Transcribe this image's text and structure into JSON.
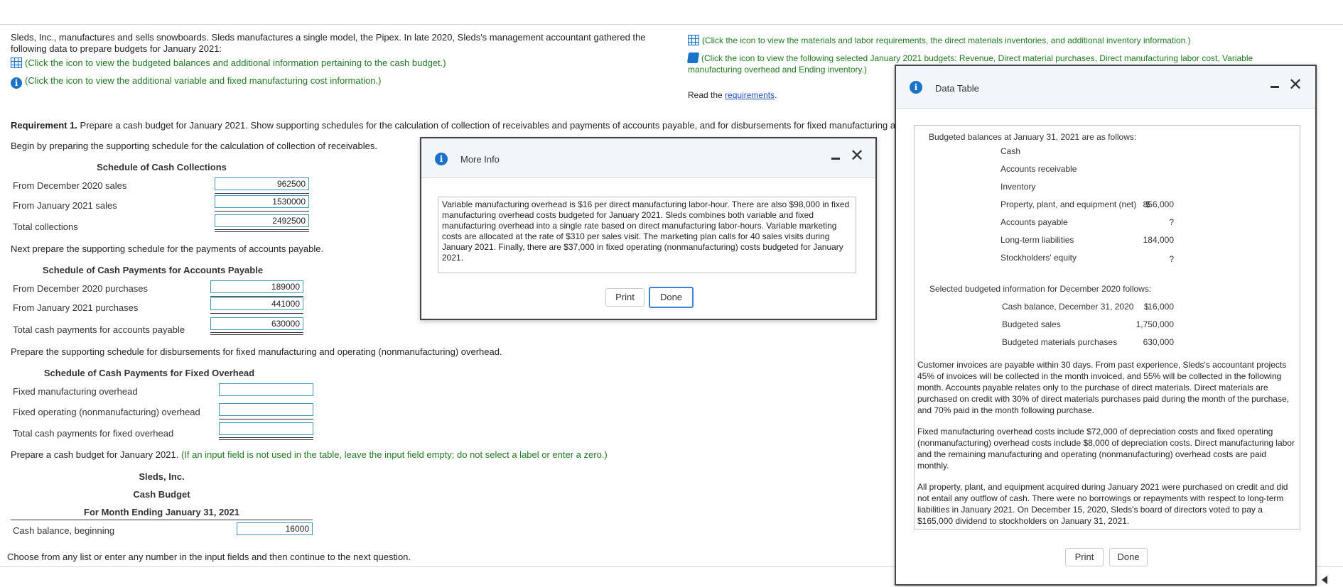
{
  "problem": {
    "intro": "Sleds, Inc., manufactures and sells snowboards. Sleds manufactures a single model, the Pipex. In late 2020, Sleds's management accountant gathered the following data to prepare budgets for January 2021:",
    "link_cash": "(Click the icon to view the budgeted balances and additional information pertaining to the cash budget.)",
    "link_overhead": "(Click the icon to view the additional variable and fixed manufacturing cost information.)",
    "link_materials": "(Click the icon to view the materials and labor requirements, the direct materials inventories, and additional inventory information.)",
    "link_budgets": "(Click the icon to view the following selected January 2021 budgets: Revenue, Direct material purchases, Direct manufacturing labor cost, Variable manufacturing overhead and Ending inventory.)",
    "read_prefix": "Read the ",
    "read_link": "requirements",
    "read_suffix": "."
  },
  "requirement": {
    "label": "Requirement 1.",
    "text": " Prepare a cash budget for January 2021. Show supporting schedules for the calculation of collection of receivables and payments of accounts payable, and for disbursements for fixed manufacturing a",
    "step1": "Begin by preparing the supporting schedule for the calculation of collection of receivables.",
    "step2": "Next prepare the supporting schedule for the payments of accounts payable.",
    "step3": "Prepare the supporting schedule for disbursements for fixed manufacturing and operating (nonmanufacturing) overhead.",
    "step4_prefix": "Prepare a cash budget for January 2021. ",
    "step4_note": "(If an input field is not used in the table, leave the input field empty; do not select a label or enter a zero.)"
  },
  "collections": {
    "title": "Schedule of Cash Collections",
    "rows": [
      {
        "label": "From December 2020 sales",
        "value": "962500"
      },
      {
        "label": "From January 2021 sales",
        "value": "1530000"
      },
      {
        "label": "Total collections",
        "value": "2492500"
      }
    ]
  },
  "payables": {
    "title": "Schedule of Cash Payments for Accounts Payable",
    "rows": [
      {
        "label": "From December 2020 purchases",
        "value": "189000"
      },
      {
        "label": "From January 2021 purchases",
        "value": "441000"
      },
      {
        "label": "Total cash payments for accounts payable",
        "value": "630000"
      }
    ]
  },
  "fixed": {
    "title": "Schedule of Cash Payments for Fixed Overhead",
    "rows": [
      {
        "label": "Fixed manufacturing overhead",
        "value": ""
      },
      {
        "label": "Fixed operating (nonmanufacturing) overhead",
        "value": ""
      },
      {
        "label": "Total cash payments for fixed overhead",
        "value": ""
      }
    ]
  },
  "cash_budget": {
    "company": "Sleds, Inc.",
    "title": "Cash Budget",
    "period": "For Month Ending January 31, 2021",
    "row_label": "Cash balance, beginning",
    "row_value": "16000"
  },
  "footer": {
    "instruction": "Choose from any list or enter any number in the input fields and then continue to the next question."
  },
  "more_info": {
    "title": "More Info",
    "text": "Variable manufacturing overhead is $16 per direct manufacturing labor-hour. There are also $98,000 in fixed manufacturing overhead costs budgeted for January 2021. Sleds combines both variable and fixed manufacturing overhead into a single rate based on direct manufacturing labor-hours. Variable marketing costs are allocated at the rate of $310 per sales visit. The marketing plan calls for 40 sales visits during January 2021. Finally, there are $37,000 in fixed operating (nonmanufacturing) costs budgeted for January 2021.",
    "print_label": "Print",
    "done_label": "Done"
  },
  "data_table": {
    "title": "Data Table",
    "balances_heading": "Budgeted balances at January 31, 2021 are as follows:",
    "balances": [
      {
        "label": "Cash",
        "dollar": "",
        "value": "?"
      },
      {
        "label": "Accounts receivable",
        "dollar": "",
        "value": "?"
      },
      {
        "label": "Inventory",
        "dollar": "",
        "value": "?"
      },
      {
        "label": "Property, plant, and equipment (net)",
        "dollar": "$",
        "value": "856,000"
      },
      {
        "label": "Accounts payable",
        "dollar": "",
        "value": "?"
      },
      {
        "label": "Long-term liabilities",
        "dollar": "",
        "value": "184,000"
      },
      {
        "label": "Stockholders' equity",
        "dollar": "",
        "value": "?"
      }
    ],
    "december_heading": "Selected budgeted information for December 2020 follows:",
    "december": [
      {
        "label": "Cash balance, December 31, 2020",
        "dollar": "$",
        "value": "16,000"
      },
      {
        "label": "Budgeted sales",
        "dollar": "",
        "value": "1,750,000"
      },
      {
        "label": "Budgeted materials purchases",
        "dollar": "",
        "value": "630,000"
      }
    ],
    "para1": "Customer invoices are payable within 30 days. From past experience, Sleds's accountant projects 45% of invoices will be collected in the month invoiced, and 55% will be collected in the following month. Accounts payable relates only to the purchase of direct materials. Direct materials are purchased on credit with 30% of direct materials purchases paid during the month of the purchase, and 70% paid in the month following purchase.",
    "para2": "Fixed manufacturing overhead costs include $72,000 of depreciation costs and fixed operating (nonmanufacturing) overhead costs include $8,000 of depreciation costs. Direct manufacturing labor and the remaining manufacturing and operating (nonmanufacturing) overhead costs are paid monthly.",
    "para3": "All property, plant, and equipment acquired during January 2021 were purchased on credit and did not entail any outflow of cash. There were no borrowings or repayments with respect to long-term liabilities in January 2021. On December 15, 2020, Sleds's board of directors voted to pay a $165,000 dividend to stockholders on January 31, 2021.",
    "print_label": "Print",
    "done_label": "Done"
  },
  "icons": {
    "info": "info-icon",
    "grid": "table-icon",
    "book": "document-icon",
    "minimize": "minimize-icon",
    "close": "close-icon"
  }
}
